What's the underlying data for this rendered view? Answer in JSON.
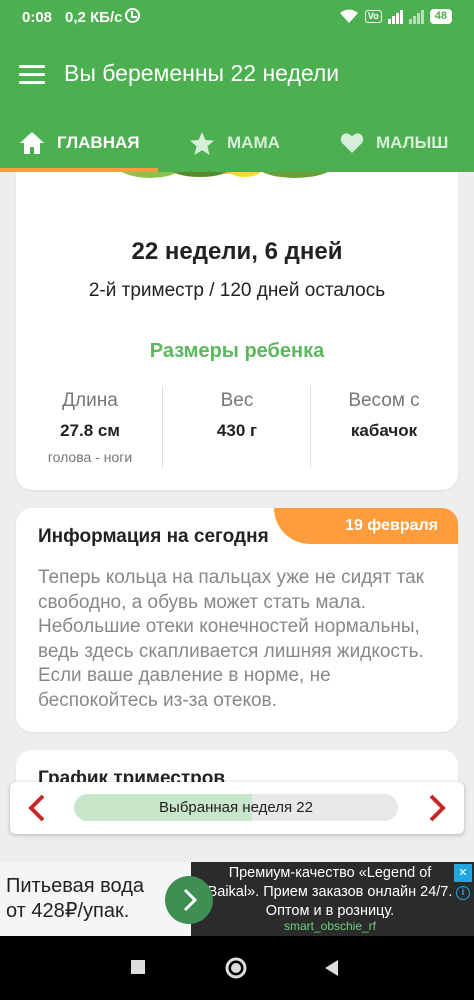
{
  "status_bar": {
    "time": "0:08",
    "speed": "0,2 КБ/с",
    "volte": "Vo LTE",
    "network": "4G",
    "battery": "48"
  },
  "app_bar": {
    "title": "Вы беременны 22 недели",
    "menu_icon": "hamburger-menu-icon"
  },
  "tabs": [
    {
      "label": "ГЛАВНАЯ",
      "icon": "home-icon",
      "active": true
    },
    {
      "label": "МАМА",
      "icon": "star-icon",
      "active": false
    },
    {
      "label": "МАЛЫШ",
      "icon": "heart-icon",
      "active": false
    }
  ],
  "week_card": {
    "week_title": "22 недели, 6 дней",
    "trimester": "2-й триместр / 120 дней осталось",
    "size_header": "Размеры ребенка",
    "stats": [
      {
        "label": "Длина",
        "value": "27.8 см",
        "sub": "голова - ноги"
      },
      {
        "label": "Вес",
        "value": "430 г",
        "sub": ""
      },
      {
        "label": "Весом с",
        "value": "кабачок",
        "sub": ""
      }
    ]
  },
  "info_card": {
    "title": "Информация на сегодня",
    "date": "19 февраля",
    "text": "Теперь кольца на пальцах уже не сидят так свободно, а обувь может стать мала. Небольшие отеки конечностей нормальны, ведь здесь скапливается лишняя жидкость. Если ваше давление в норме, не беспокойтесь из-за отеков."
  },
  "trimester_card": {
    "title": "График триместров"
  },
  "week_selector": {
    "label": "Выбранная неделя 22",
    "progress": 0.55,
    "prev_icon": "chevron-left-icon",
    "next_icon": "chevron-right-icon"
  },
  "ad": {
    "left_text": "Питьевая вода от 428₽/упак.",
    "right_text": "Премиум-качество «Legend of Baikal». Прием заказов онлайн 24/7. Оптом и в розницу.",
    "source": "smart_obschie_rf"
  },
  "colors": {
    "primary": "#4caf50",
    "accent": "#ff9d3c",
    "header_green": "#5cb85c",
    "nav_red": "#c62828"
  }
}
